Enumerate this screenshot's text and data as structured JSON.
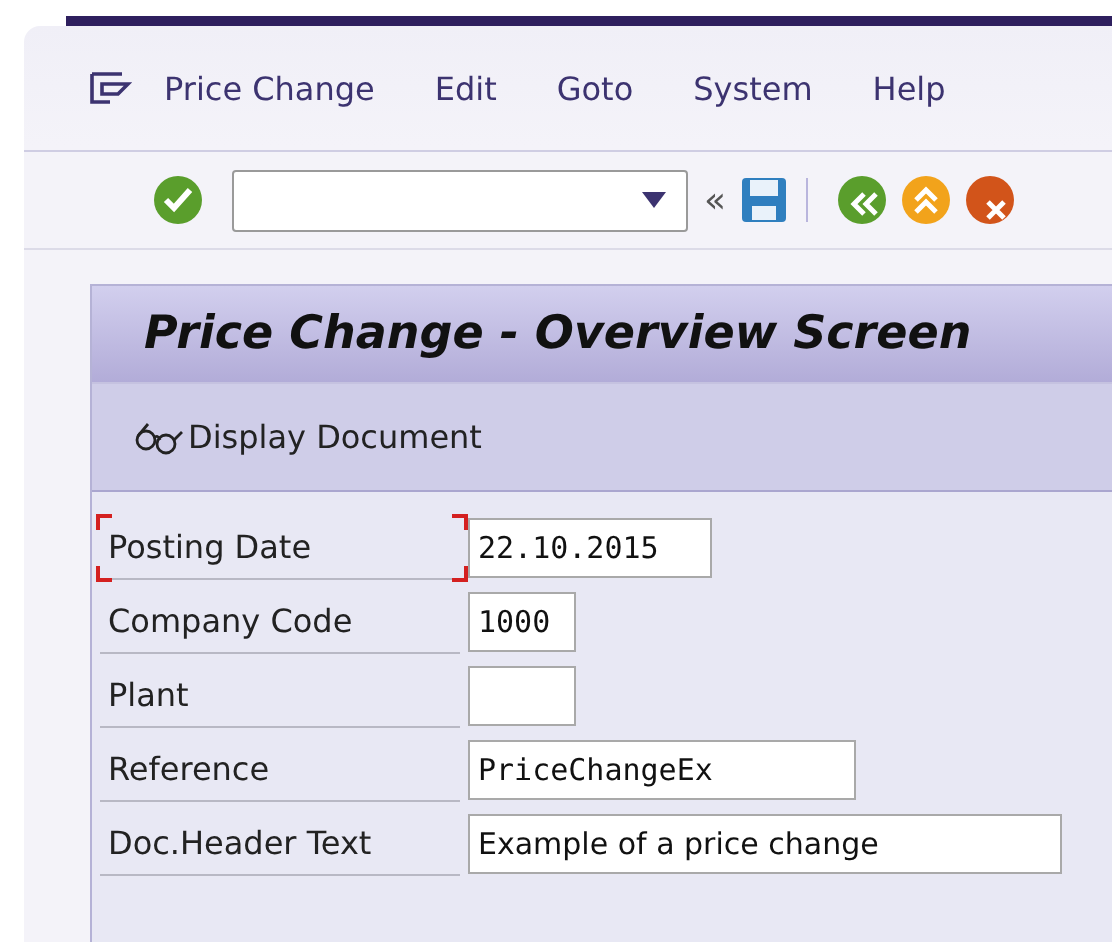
{
  "menu": [
    {
      "label": "Price Change"
    },
    {
      "label": "Edit"
    },
    {
      "label": "Goto"
    },
    {
      "label": "System"
    },
    {
      "label": "Help"
    }
  ],
  "toolbar": {
    "expand": "«"
  },
  "screen": {
    "title": "Price Change - Overview Screen",
    "actions": [
      {
        "label": "Display Document"
      }
    ]
  },
  "fields": [
    {
      "label": "Posting Date",
      "value": "22.10.2015",
      "kind": "code",
      "focused": true
    },
    {
      "label": "Company Code",
      "value": "1000",
      "kind": "code",
      "focused": false
    },
    {
      "label": "Plant",
      "kind": "code",
      "focused": false
    },
    {
      "label": "Reference",
      "value": "PriceChangeEx",
      "kind": "code",
      "focused": false
    },
    {
      "label": "Doc.Header Text",
      "value": "Example of a price change",
      "kind": "text",
      "focused": false
    }
  ]
}
